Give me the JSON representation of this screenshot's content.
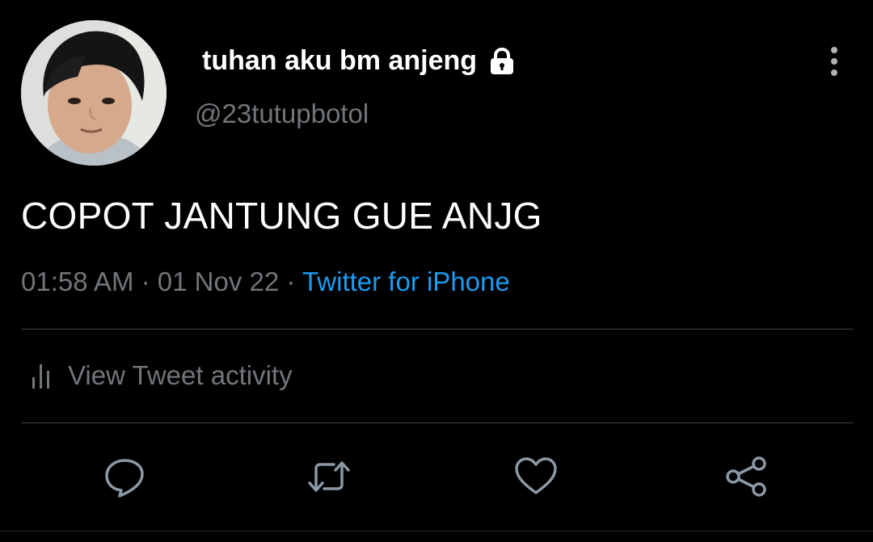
{
  "tweet": {
    "display_name": "tuhan aku bm anjeng",
    "handle": "@23tutupbotol",
    "text": "COPOT JANTUNG GUE ANJG",
    "time": "01:58 AM",
    "date": "01 Nov 22",
    "separator": "·",
    "source": "Twitter for iPhone",
    "protected": true
  },
  "activity": {
    "label": "View Tweet activity",
    "icon": "bar-chart-icon"
  },
  "actions": [
    {
      "name": "reply",
      "icon": "reply-icon"
    },
    {
      "name": "retweet",
      "icon": "retweet-icon"
    },
    {
      "name": "like",
      "icon": "heart-icon"
    },
    {
      "name": "share",
      "icon": "share-icon"
    }
  ],
  "colors": {
    "background": "#000000",
    "primary_text": "#ffffff",
    "secondary_text": "#71767b",
    "link": "#1d9bf0",
    "divider": "#3a3d40"
  }
}
